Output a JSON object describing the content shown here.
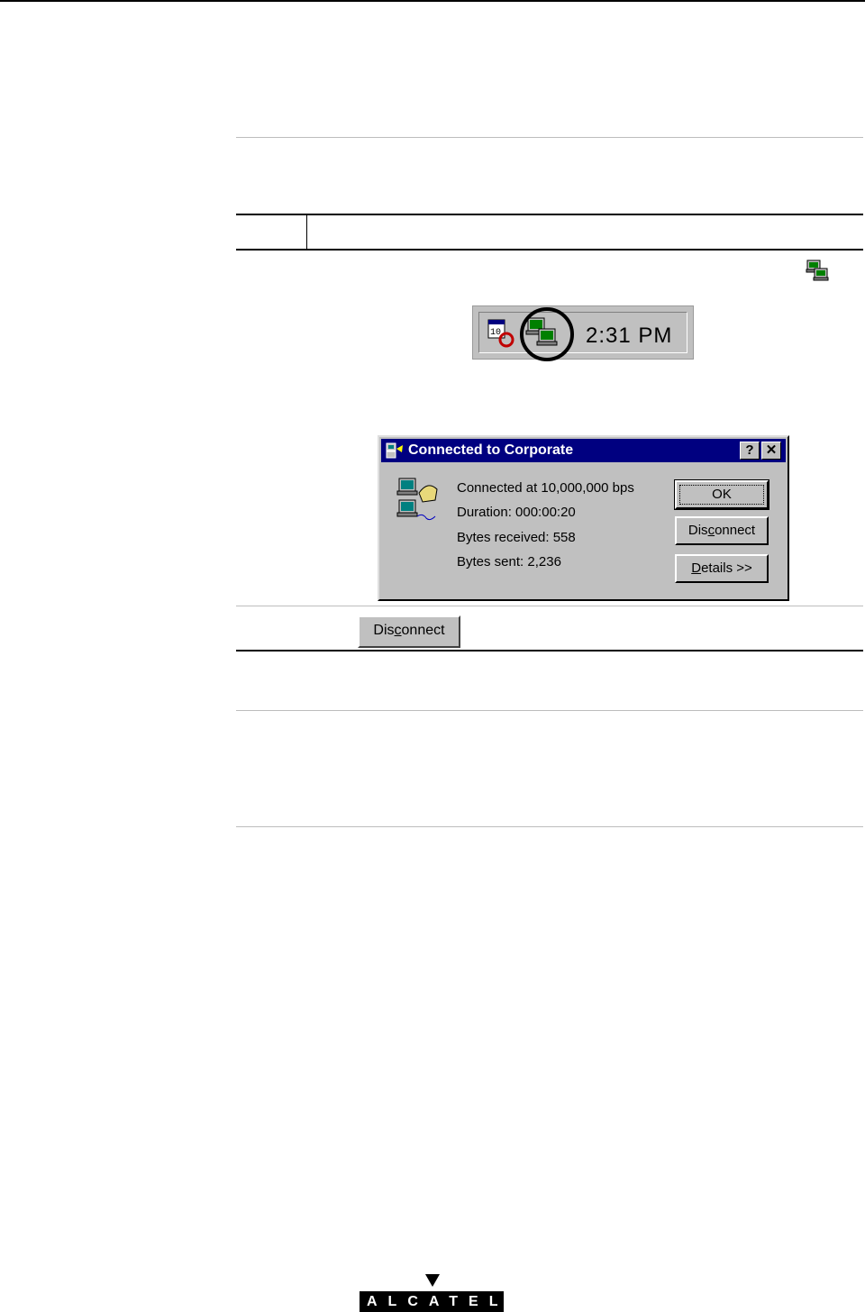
{
  "tray": {
    "time": "2:31 PM"
  },
  "dialog": {
    "title": "Connected to Corporate",
    "help_label": "?",
    "close_label": "✕",
    "lines": [
      "Connected at 10,000,000 bps",
      "Duration:  000:00:20",
      "Bytes received:  558",
      "Bytes sent:  2,236"
    ],
    "ok_label": "OK",
    "disconnect_pre": "Dis",
    "disconnect_ul": "c",
    "disconnect_post": "onnect",
    "details_ul": "D",
    "details_post": "etails >>"
  },
  "standalone_button": {
    "pre": "Dis",
    "ul": "c",
    "post": "onnect"
  },
  "footer": {
    "logo": "ALCATEL"
  }
}
